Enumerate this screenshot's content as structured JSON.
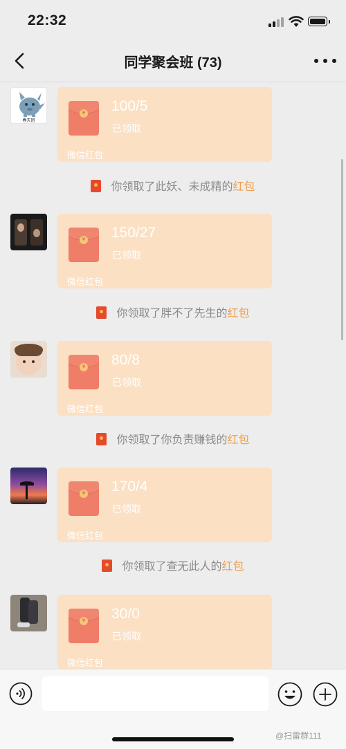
{
  "status_bar": {
    "time": "22:32"
  },
  "header": {
    "title": "同学聚会班 (73)"
  },
  "messages": [
    {
      "amount": "100/5",
      "status": "已领取",
      "brand": "微信红包",
      "notice_prefix": "你领取了此妖、未成精的",
      "notice_link": "红包"
    },
    {
      "amount": "150/27",
      "status": "已领取",
      "brand": "微信红包",
      "notice_prefix": "你领取了胖不了先生的",
      "notice_link": "红包"
    },
    {
      "amount": "80/8",
      "status": "已领取",
      "brand": "微信红包",
      "notice_prefix": "你领取了你负责赚钱的",
      "notice_link": "红包"
    },
    {
      "amount": "170/4",
      "status": "已领取",
      "brand": "微信红包",
      "notice_prefix": "你领取了查无此人的",
      "notice_link": "红包"
    },
    {
      "amount": "30/0",
      "status": "已领取",
      "brand": "微信红包"
    }
  ],
  "avatar_caption": "春天团",
  "watermark": "@扫雷群111",
  "colors": {
    "card_bg": "#fbe0c4",
    "envelope": "#ef7d67",
    "link": "#f0a04b",
    "background": "#ededed"
  }
}
